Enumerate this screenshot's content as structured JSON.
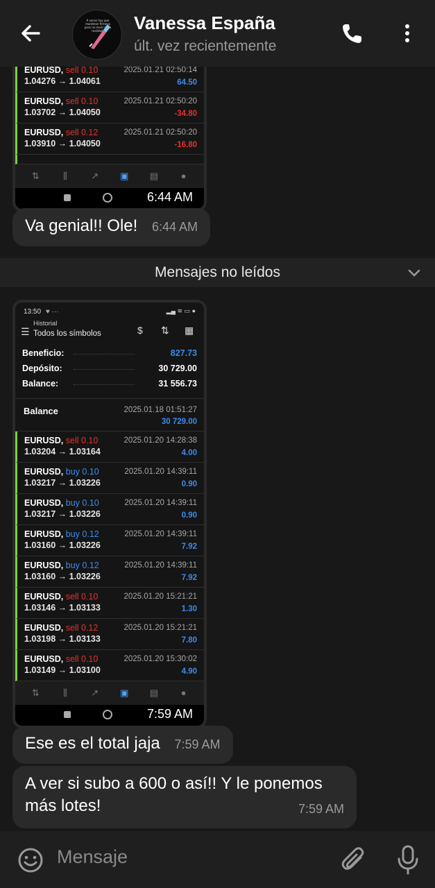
{
  "header": {
    "contact_name": "Vanessa España",
    "status": "últ. vez recientemente",
    "avatar_text": "A veces hay que mantener firmeza para no morir de la realidad."
  },
  "messages": {
    "img1_time": "6:44 AM",
    "img1_trades": [
      {
        "sym": "EURUSD,",
        "side": "sell",
        "lot": "0.10",
        "prices": "1.04276 → 1.04061",
        "date": "2025.01.21 02:50:14",
        "profit": "64.50",
        "sign": "pos"
      },
      {
        "sym": "EURUSD,",
        "side": "sell",
        "lot": "0.10",
        "prices": "1.03702 → 1.04050",
        "date": "2025.01.21 02:50:20",
        "profit": "-34.80",
        "sign": "neg"
      },
      {
        "sym": "EURUSD,",
        "side": "sell",
        "lot": "0.12",
        "prices": "1.03910 → 1.04050",
        "date": "2025.01.21 02:50:20",
        "profit": "-16.80",
        "sign": "neg"
      }
    ],
    "text1": {
      "body": "Va genial!! Ole!",
      "time": "6:44 AM"
    },
    "unread_label": "Mensajes no leídos",
    "img2": {
      "status_time": "13:50",
      "history_label": "Historial",
      "symbols_label": "Todos los símbolos",
      "beneficio_label": "Beneficio:",
      "beneficio_value": "827.73",
      "deposito_label": "Depósito:",
      "deposito_value": "30 729.00",
      "balance_label": "Balance:",
      "balance_value": "31 556.73",
      "balance_entry_label": "Balance",
      "balance_entry_date": "2025.01.18 01:51:27",
      "balance_entry_amount": "30 729.00",
      "time": "7:59 AM"
    },
    "img2_trades": [
      {
        "sym": "EURUSD,",
        "side": "sell",
        "lot": "0.10",
        "prices": "1.03204 → 1.03164",
        "date": "2025.01.20 14:28:38",
        "profit": "4.00",
        "sign": "pos"
      },
      {
        "sym": "EURUSD,",
        "side": "buy",
        "lot": "0.10",
        "prices": "1.03217 → 1.03226",
        "date": "2025.01.20 14:39:11",
        "profit": "0.90",
        "sign": "pos"
      },
      {
        "sym": "EURUSD,",
        "side": "buy",
        "lot": "0.10",
        "prices": "1.03217 → 1.03226",
        "date": "2025.01.20 14:39:11",
        "profit": "0.90",
        "sign": "pos"
      },
      {
        "sym": "EURUSD,",
        "side": "buy",
        "lot": "0.12",
        "prices": "1.03160 → 1.03226",
        "date": "2025.01.20 14:39:11",
        "profit": "7.92",
        "sign": "pos"
      },
      {
        "sym": "EURUSD,",
        "side": "buy",
        "lot": "0.12",
        "prices": "1.03160 → 1.03226",
        "date": "2025.01.20 14:39:11",
        "profit": "7.92",
        "sign": "pos"
      },
      {
        "sym": "EURUSD,",
        "side": "sell",
        "lot": "0.10",
        "prices": "1.03146 → 1.03133",
        "date": "2025.01.20 15:21:21",
        "profit": "1.30",
        "sign": "pos"
      },
      {
        "sym": "EURUSD,",
        "side": "sell",
        "lot": "0.12",
        "prices": "1.03198 → 1.03133",
        "date": "2025.01.20 15:21:21",
        "profit": "7.80",
        "sign": "pos"
      },
      {
        "sym": "EURUSD,",
        "side": "sell",
        "lot": "0.10",
        "prices": "1.03149 → 1.03100",
        "date": "2025.01.20 15:30:02",
        "profit": "4.90",
        "sign": "pos"
      }
    ],
    "text2": {
      "body": "Ese es el total jaja",
      "time": "7:59 AM"
    },
    "text3": {
      "line1": "A ver si subo a 600 o así!! Y le ponemos",
      "line2": "más lotes!",
      "time": "7:59 AM"
    }
  },
  "input": {
    "placeholder": "Mensaje"
  },
  "icons": {
    "back": "back-arrow-icon",
    "call": "phone-icon",
    "more": "more-vertical-icon",
    "emoji": "emoji-icon",
    "attach": "paperclip-icon",
    "mic": "microphone-icon",
    "chevron": "chevron-down-icon"
  }
}
